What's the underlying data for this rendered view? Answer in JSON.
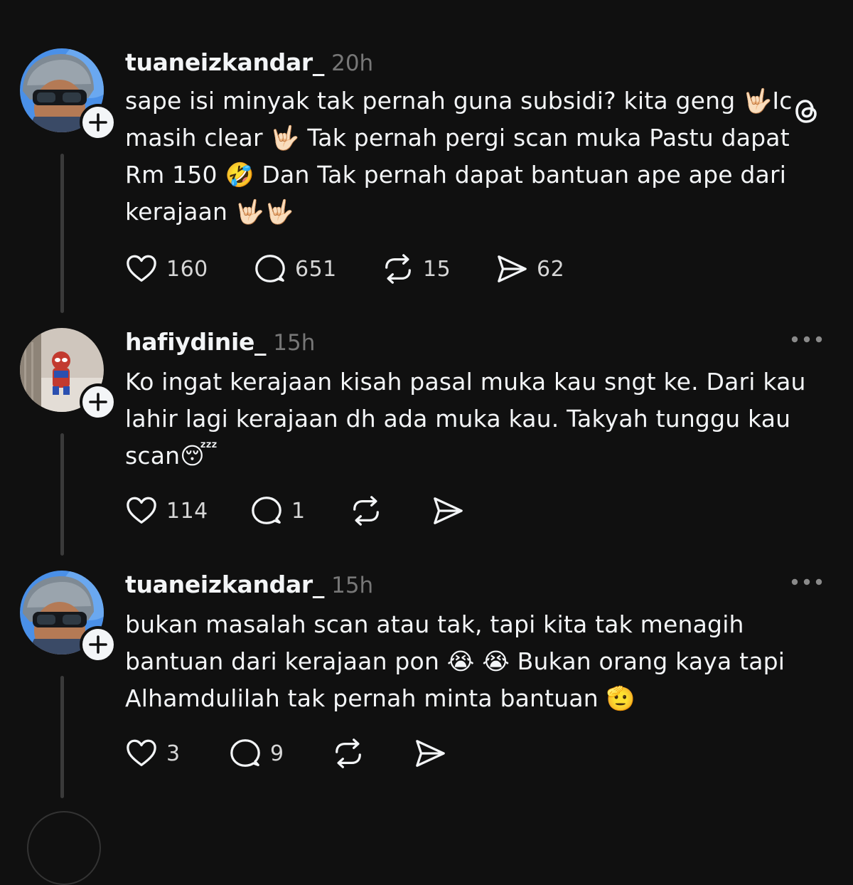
{
  "app": {
    "theme_bg": "#101010",
    "text_color": "#f3f5f7",
    "muted_color": "#777777",
    "thread_line_color": "#3a3a3a"
  },
  "posts": [
    {
      "username": "tuaneizkandar_",
      "time": "20h",
      "text": "sape isi minyak tak pernah guna subsidi? kita geng 🤟🏻Ic masih clear 🤟🏻 Tak pernah pergi scan muka Pastu dapat Rm 150 🤣 Dan Tak pernah dapat bantuan ape ape dari kerajaan 🤟🏻🤟🏻",
      "corner_icon": "threads-logo-icon",
      "likes": "160",
      "replies": "651",
      "reposts": "15",
      "shares": "62"
    },
    {
      "username": "hafiydinie_",
      "time": "15h",
      "text": "Ko ingat kerajaan kisah pasal muka kau sngt ke. Dari kau lahir lagi kerajaan dh ada muka kau. Takyah tunggu kau scan😴",
      "corner_icon": "more-options-icon",
      "likes": "114",
      "replies": "1",
      "reposts": "",
      "shares": ""
    },
    {
      "username": "tuaneizkandar_",
      "time": "15h",
      "text": "bukan masalah scan atau tak, tapi kita tak menagih bantuan  dari kerajaan pon 😭 😭  Bukan orang kaya tapi Alhamdulilah tak pernah minta bantuan 🫡",
      "corner_icon": "more-options-icon",
      "likes": "3",
      "replies": "9",
      "reposts": "",
      "shares": ""
    }
  ]
}
